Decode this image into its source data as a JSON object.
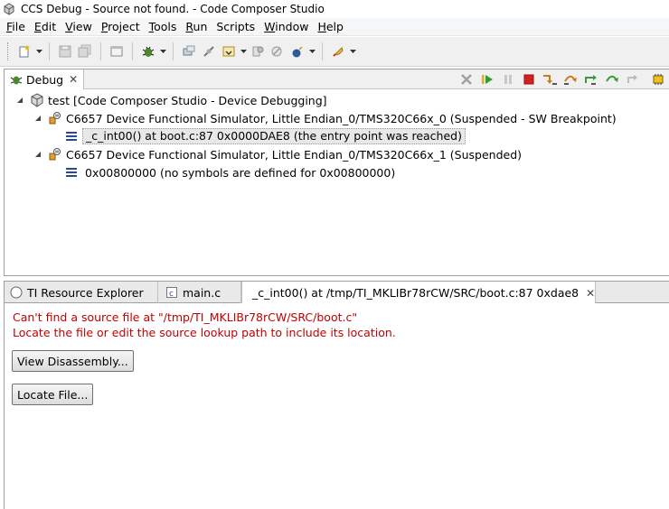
{
  "window": {
    "title": "CCS Debug - Source not found. - Code Composer Studio"
  },
  "menu": [
    {
      "label": "File",
      "mnemonic": "F",
      "rest": "ile"
    },
    {
      "label": "Edit",
      "mnemonic": "E",
      "rest": "dit"
    },
    {
      "label": "View",
      "mnemonic": "V",
      "rest": "iew"
    },
    {
      "label": "Project",
      "mnemonic": "P",
      "rest": "roject"
    },
    {
      "label": "Tools",
      "mnemonic": "T",
      "rest": "ools"
    },
    {
      "label": "Run",
      "mnemonic": "R",
      "rest": "un"
    },
    {
      "label": "Scripts",
      "mnemonic": "",
      "rest": "Scripts"
    },
    {
      "label": "Window",
      "mnemonic": "W",
      "rest": "indow"
    },
    {
      "label": "Help",
      "mnemonic": "H",
      "rest": "elp"
    }
  ],
  "debug_view": {
    "tab_label": "Debug",
    "tree": {
      "root": "test [Code Composer Studio - Device Debugging]",
      "core0": "C6657 Device Functional Simulator, Little Endian_0/TMS320C66x_0 (Suspended - SW Breakpoint)",
      "core0_frame": "_c_int00() at boot.c:87 0x0000DAE8  (the entry point was reached)",
      "core1": "C6657 Device Functional Simulator, Little Endian_0/TMS320C66x_1 (Suspended)",
      "core1_frame": "0x00800000  (no symbols are defined for 0x00800000)"
    }
  },
  "editor": {
    "tabs": {
      "resource_explorer": "TI Resource Explorer",
      "main_c": "main.c",
      "boot_c": "_c_int00() at /tmp/TI_MKLIBr78rCW/SRC/boot.c:87 0xdae8"
    },
    "message_line1": "Can't find a source file at \"/tmp/TI_MKLIBr78rCW/SRC/boot.c\"",
    "message_line2": "Locate the file or edit the source lookup path to include its location.",
    "view_disassembly_button": "View Disassembly...",
    "locate_file_button": "Locate File..."
  },
  "colors": {
    "error_text": "#c00000",
    "terminate_red": "#d42020",
    "resume_green": "#2e9e2e",
    "step_orange": "#d07a1a"
  }
}
